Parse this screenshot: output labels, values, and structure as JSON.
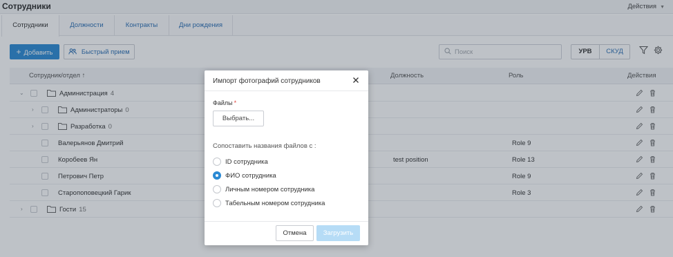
{
  "header": {
    "title": "Сотрудники",
    "actions_label": "Действия"
  },
  "tabs": [
    {
      "label": "Сотрудники",
      "active": true
    },
    {
      "label": "Должности",
      "active": false
    },
    {
      "label": "Контракты",
      "active": false
    },
    {
      "label": "Дни рождения",
      "active": false
    }
  ],
  "toolbar": {
    "add_label": "Добавить",
    "quick_hire_label": "Быстрый прием",
    "search_placeholder": "Поиск",
    "segment_urv": "УРВ",
    "segment_skud": "СКУД"
  },
  "table": {
    "columns": {
      "employee": "Сотрудник/отдел ↑",
      "position": "Должность",
      "role": "Роль",
      "actions": "Действия"
    },
    "rows": [
      {
        "name": "Администрация",
        "count": "4",
        "position": "",
        "role": ""
      },
      {
        "name": "Администраторы",
        "count": "0",
        "position": "",
        "role": ""
      },
      {
        "name": "Разработка",
        "count": "0",
        "position": "",
        "role": ""
      },
      {
        "name": "Валерьянов Дмитрий",
        "count": "",
        "position": "",
        "role": "Role 9"
      },
      {
        "name": "Коробеев Ян",
        "count": "",
        "position": "test position",
        "role": "Role 13"
      },
      {
        "name": "Петрович Петр",
        "count": "",
        "position": "",
        "role": "Role 9"
      },
      {
        "name": "Старопоповецкий Гарик",
        "count": "",
        "position": "",
        "role": "Role 3"
      },
      {
        "name": "Гости",
        "count": "15",
        "position": "",
        "role": ""
      }
    ]
  },
  "modal": {
    "title": "Импорт фотографий сотрудников",
    "files_label": "Файлы",
    "required_mark": "*",
    "choose_label": "Выбрать...",
    "match_label": "Сопоставить названия файлов с :",
    "options": [
      {
        "label": "ID сотрудника",
        "checked": false
      },
      {
        "label": "ФИО сотрудника",
        "checked": true
      },
      {
        "label": "Личным номером сотрудника",
        "checked": false
      },
      {
        "label": "Табельным номером сотрудника",
        "checked": false
      }
    ],
    "cancel_label": "Отмена",
    "upload_label": "Загрузить"
  },
  "colors": {
    "primary": "#2b8ad4",
    "link": "#2b6fb4",
    "upload_disabled": "#b6dcf6",
    "required": "#e0443d"
  }
}
